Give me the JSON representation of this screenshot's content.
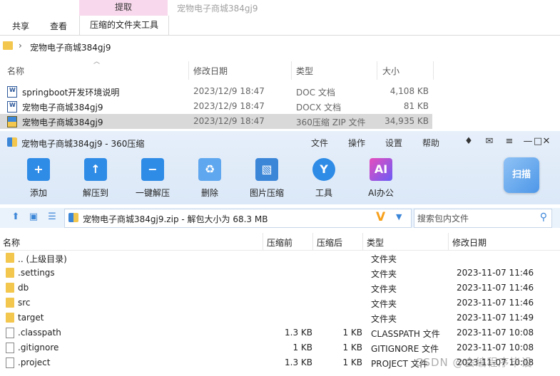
{
  "explorer": {
    "contextual_tab_header": "提取",
    "window_title": "宠物电子商城384gj9",
    "tabs": [
      "共享",
      "查看",
      "压缩的文件夹工具"
    ],
    "breadcrumb": "宠物电子商城384gj9",
    "columns": {
      "name": "名称",
      "date": "修改日期",
      "type": "类型",
      "size": "大小"
    },
    "files": [
      {
        "name": "springboot开发环境说明",
        "date": "2023/12/9 18:47",
        "type": "DOC 文档",
        "size": "4,108 KB",
        "icon": "word-doc-icon"
      },
      {
        "name": "宠物电子商城384gj9",
        "date": "2023/12/9 18:47",
        "type": "DOCX 文档",
        "size": "81 KB",
        "icon": "word-docx-icon"
      },
      {
        "name": "宠物电子商城384gj9",
        "date": "2023/12/9 18:47",
        "type": "360压缩 ZIP 文件",
        "size": "34,935 KB",
        "icon": "zip-archive-icon",
        "selected": true
      }
    ]
  },
  "zip": {
    "title": "宠物电子商城384gj9 - 360压缩",
    "menu": [
      "文件",
      "操作",
      "设置",
      "帮助"
    ],
    "window_controls": {
      "skin": "♦",
      "message": "✉",
      "menu": "≡",
      "minimize": "—",
      "maximize": "□",
      "close": "✕"
    },
    "toolbar": [
      {
        "label": "添加",
        "icon": "add-icon",
        "glyph": "+",
        "color": "#2e8be6"
      },
      {
        "label": "解压到",
        "icon": "extract-to-icon",
        "glyph": "↑",
        "color": "#2e8be6"
      },
      {
        "label": "一键解压",
        "icon": "one-click-extract-icon",
        "glyph": "−",
        "color": "#2e8be6"
      },
      {
        "label": "删除",
        "icon": "recycle-delete-icon",
        "glyph": "♻",
        "color": "#5fa7ee"
      },
      {
        "label": "图片压缩",
        "icon": "image-compress-icon",
        "glyph": "▧",
        "color": "#3c86d8"
      },
      {
        "label": "工具",
        "icon": "tools-icon",
        "glyph": "Y",
        "color": "#2e8be6"
      },
      {
        "label": "AI办公",
        "icon": "ai-office-icon",
        "glyph": "AI",
        "color": "#7a5cf0"
      }
    ],
    "scan_button": "扫描",
    "path": "宠物电子商城384gj9.zip - 解包大小为 68.3 MB",
    "search_placeholder": "搜索包内文件",
    "columns": {
      "name": "名称",
      "compressed": "压缩前",
      "after": "压缩后",
      "type": "类型",
      "date": "修改日期"
    },
    "rows": [
      {
        "name": ".. (上级目录)",
        "before": "",
        "after": "",
        "type": "文件夹",
        "date": "",
        "kind": "folder"
      },
      {
        "name": ".settings",
        "before": "",
        "after": "",
        "type": "文件夹",
        "date": "2023-11-07 11:46",
        "kind": "folder"
      },
      {
        "name": "db",
        "before": "",
        "after": "",
        "type": "文件夹",
        "date": "2023-11-07 11:46",
        "kind": "folder"
      },
      {
        "name": "src",
        "before": "",
        "after": "",
        "type": "文件夹",
        "date": "2023-11-07 11:46",
        "kind": "folder"
      },
      {
        "name": "target",
        "before": "",
        "after": "",
        "type": "文件夹",
        "date": "2023-11-07 11:49",
        "kind": "folder"
      },
      {
        "name": ".classpath",
        "before": "1.3 KB",
        "after": "1 KB",
        "type": "CLASSPATH 文件",
        "date": "2023-11-07 10:08",
        "kind": "file"
      },
      {
        "name": ".gitignore",
        "before": "1 KB",
        "after": "1 KB",
        "type": "GITIGNORE 文件",
        "date": "2023-11-07 10:08",
        "kind": "file"
      },
      {
        "name": ".project",
        "before": "1.3 KB",
        "after": "1 KB",
        "type": "PROJECT 文件",
        "date": "2023-11-07 10:08",
        "kind": "file"
      }
    ]
  },
  "watermark": "CSDN @会编程序毕设"
}
